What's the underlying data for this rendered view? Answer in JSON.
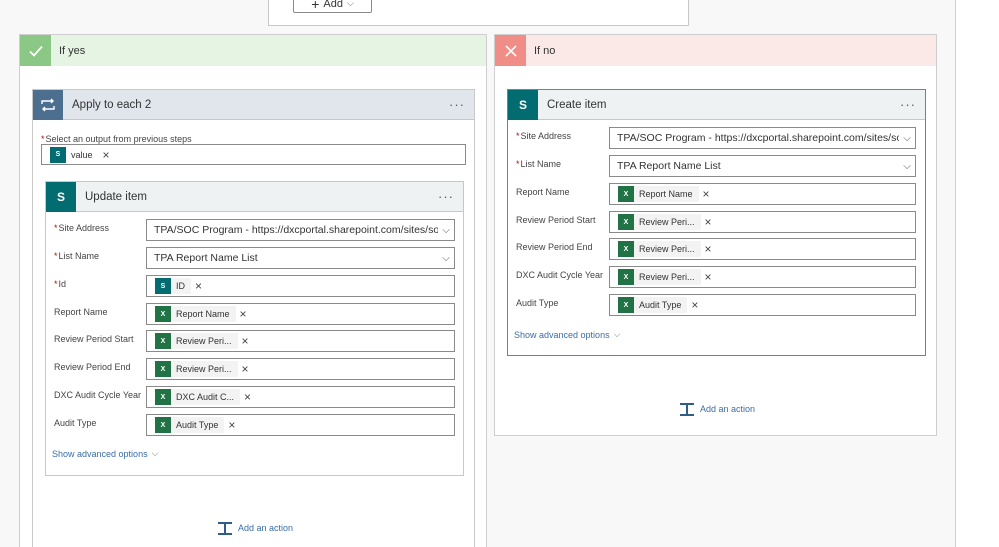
{
  "top": {
    "add_label": "Add"
  },
  "yes_branch": {
    "title": "If yes",
    "apply_each": {
      "title": "Apply to each 2",
      "select_label": "Select an output from previous steps",
      "select_token": "value",
      "update_item": {
        "title": "Update item",
        "fields": {
          "site_address": {
            "label": "Site Address",
            "value": "TPA/SOC Program - https://dxcportal.sharepoint.com/sites/soc..."
          },
          "list_name": {
            "label": "List Name",
            "value": "TPA Report Name List"
          },
          "id": {
            "label": "Id",
            "token": "ID"
          },
          "report_name": {
            "label": "Report Name",
            "token": "Report Name"
          },
          "review_start": {
            "label": "Review Period Start",
            "token": "Review Peri..."
          },
          "review_end": {
            "label": "Review Period End",
            "token": "Review Peri..."
          },
          "audit_cycle": {
            "label": "DXC Audit Cycle Year",
            "token": "DXC Audit C..."
          },
          "audit_type": {
            "label": "Audit Type",
            "token": "Audit Type"
          }
        },
        "advanced": "Show advanced options"
      },
      "add_action": "Add an action"
    }
  },
  "no_branch": {
    "title": "If no",
    "create_item": {
      "title": "Create item",
      "fields": {
        "site_address": {
          "label": "Site Address",
          "value": "TPA/SOC Program - https://dxcportal.sharepoint.com/sites/soc..."
        },
        "list_name": {
          "label": "List Name",
          "value": "TPA Report Name List"
        },
        "report_name": {
          "label": "Report Name",
          "token": "Report Name"
        },
        "review_start": {
          "label": "Review Period Start",
          "token": "Review Peri..."
        },
        "review_end": {
          "label": "Review Period End",
          "token": "Review Peri..."
        },
        "audit_cycle": {
          "label": "DXC Audit Cycle Year",
          "token": "Review Peri..."
        },
        "audit_type": {
          "label": "Audit Type",
          "token": "Audit Type"
        }
      },
      "advanced": "Show advanced options"
    },
    "add_action": "Add an action"
  },
  "menu_glyph": "···",
  "close_glyph": "×",
  "chevron_glyph": "⌵",
  "icons": {
    "yes": "checkmark-icon",
    "no": "close-icon",
    "loop": "loop-icon",
    "sharepoint": "sharepoint-icon",
    "excel": "excel-icon"
  },
  "colors": {
    "yes_accent": "#8bc785",
    "no_accent": "#f08d86",
    "sharepoint": "#036c70",
    "excel": "#217346",
    "link": "#3a6ea5"
  }
}
